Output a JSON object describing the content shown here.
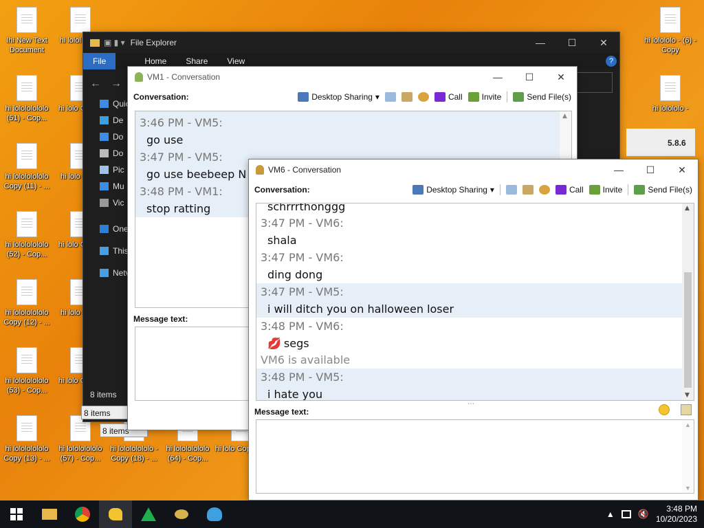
{
  "desktop_icons": [
    {
      "label": "Ihi New Text Document",
      "col": 0,
      "row": 0
    },
    {
      "label": "hi lolol (54) -",
      "col": 1,
      "row": 0
    },
    {
      "label": "hi lolololo - (6) - Copy",
      "col": 12,
      "row": 0
    },
    {
      "label": "hi lolololololo (51) - Cop...",
      "col": 0,
      "row": 1
    },
    {
      "label": "hi lolo Copy (",
      "col": 1,
      "row": 1
    },
    {
      "label": "hi lolololo -",
      "col": 12,
      "row": 1
    },
    {
      "label": "hi lolololololo Copy (11) - ...",
      "col": 0,
      "row": 2
    },
    {
      "label": "hi lolo (55) -",
      "col": 1,
      "row": 2
    },
    {
      "label": "hi lolololololo (52) - Cop...",
      "col": 0,
      "row": 3
    },
    {
      "label": "hi lolo Copy (",
      "col": 1,
      "row": 3
    },
    {
      "label": "hi lolololololo Copy (12) - ...",
      "col": 0,
      "row": 4
    },
    {
      "label": "hi lolo (56) -",
      "col": 1,
      "row": 4
    },
    {
      "label": "hi lolololololo (53) - Cop...",
      "col": 0,
      "row": 5
    },
    {
      "label": "hi lolo Copy (",
      "col": 1,
      "row": 5
    },
    {
      "label": "hi lolololololo Copy (13) - ...",
      "col": 0,
      "row": 6
    },
    {
      "label": "hi lolololololo (57) - Cop...",
      "col": 1,
      "row": 6
    },
    {
      "label": "hi lolololololo - Copy (18) - ...",
      "col": 2,
      "row": 6
    },
    {
      "label": "hi lolololololo (64) - Cop...",
      "col": 3,
      "row": 6
    },
    {
      "label": "hi lolo Copy (25",
      "col": 4,
      "row": 6
    }
  ],
  "explorer": {
    "title": "File Explorer",
    "tabs": [
      "File",
      "Home",
      "Share",
      "View"
    ],
    "nav_items": [
      "Quic",
      "De",
      "Do",
      "Do",
      "Pic",
      "Mu",
      "Vic",
      "One",
      "This",
      "Netv"
    ],
    "status": "8 items",
    "status2": "8 items",
    "status3": "8 items",
    "version": "5.8.6"
  },
  "vm1": {
    "title": "VM1 - Conversation",
    "conversation_label": "Conversation:",
    "toolbar": {
      "desktop_sharing": "Desktop Sharing",
      "call": "Call",
      "invite": "Invite",
      "send_files": "Send File(s)"
    },
    "messages": [
      {
        "header": "3:46 PM - VM5:",
        "body": "go use"
      },
      {
        "header": "3:47 PM - VM5:",
        "body": "go use beebeep N"
      },
      {
        "header": "3:48 PM - VM1:",
        "body": "stop ratting"
      }
    ],
    "message_text_label": "Message text:"
  },
  "vm6": {
    "title": "VM6 - Conversation",
    "conversation_label": "Conversation:",
    "toolbar": {
      "desktop_sharing": "Desktop Sharing",
      "call": "Call",
      "invite": "Invite",
      "send_files": "Send File(s)"
    },
    "top_cut_text": "schrrrthonggg",
    "messages": [
      {
        "header": "3:47 PM - VM6:",
        "body": "shala",
        "highlight": false
      },
      {
        "header": "3:47 PM - VM6:",
        "body": "ding dong",
        "highlight": false
      },
      {
        "header": "3:47 PM - VM5:",
        "body": "i will ditch you on halloween loser",
        "highlight": true
      },
      {
        "header": "3:48 PM - VM6:",
        "body": "segs",
        "highlight": false,
        "emoji": "💋"
      }
    ],
    "system_message": "VM6 is available",
    "last_message": {
      "header": "3:48 PM - VM5:",
      "body": "i hate you"
    },
    "message_text_label": "Message text:",
    "scroll_position": 0.75
  },
  "taskbar": {
    "time": "3:48 PM",
    "date": "10/20/2023",
    "apps": [
      "file-explorer-icon",
      "chrome-icon",
      "beebeep-icon",
      "green-triangle-app-icon",
      "bee-icon",
      "blue-shell-icon"
    ]
  },
  "colors": {
    "desktop": "#f09a1a",
    "explorer_bg": "#1e1e1e",
    "highlight": "#e6eef8",
    "taskbar": "#101418"
  }
}
